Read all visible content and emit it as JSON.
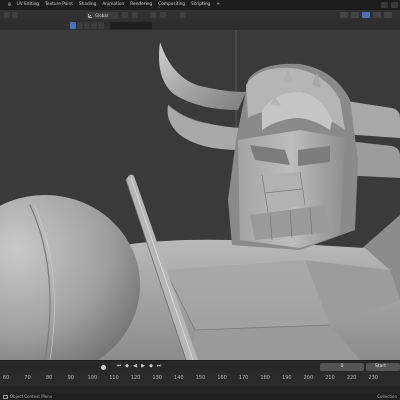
{
  "topbar": {
    "tabs": [
      "g",
      "UV Editing",
      "Texture Paint",
      "Shading",
      "Animation",
      "Rendering",
      "Compositing",
      "Scripting"
    ],
    "more_tab": "+"
  },
  "header": {
    "orientation": "Global"
  },
  "timeline": {
    "frame_value": "0",
    "start_label": "Start",
    "ticks": [
      "60",
      "70",
      "80",
      "90",
      "100",
      "110",
      "120",
      "130",
      "140",
      "150",
      "160",
      "170",
      "180",
      "190",
      "200",
      "210",
      "220",
      "230"
    ]
  },
  "status": {
    "left": "Object Context Menu",
    "right": "Collection"
  },
  "colors": {
    "accent": "#4772b3",
    "background": "#393939"
  }
}
